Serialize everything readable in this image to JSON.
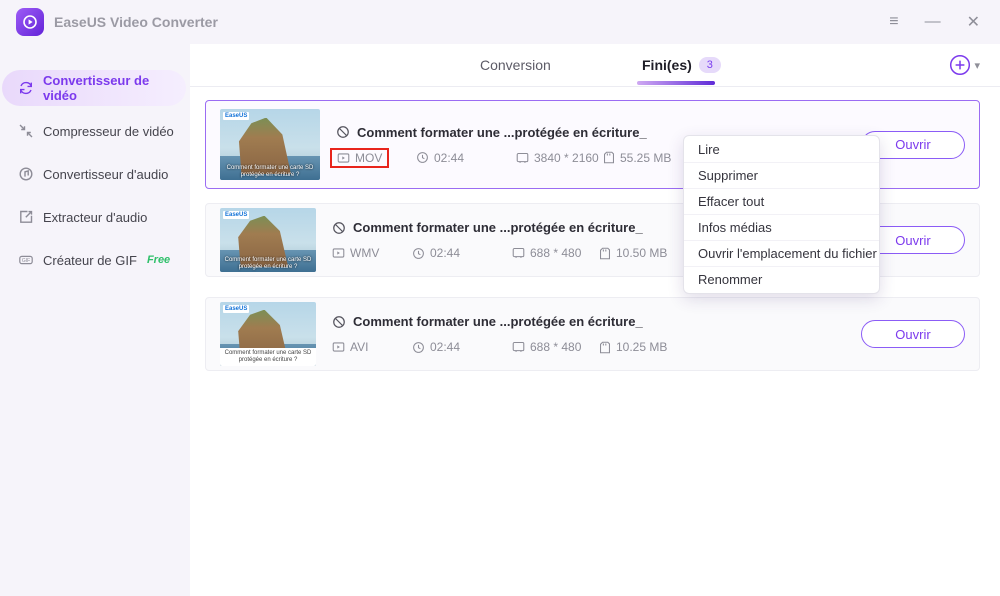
{
  "window": {
    "title": "EaseUS Video Converter",
    "controls": {
      "menu": "≡",
      "minimize": "—",
      "close": "✕"
    }
  },
  "sidebar": {
    "items": [
      {
        "label": "Convertisseur de vidéo",
        "active": true
      },
      {
        "label": "Compresseur de vidéo",
        "active": false
      },
      {
        "label": "Convertisseur d'audio",
        "active": false
      },
      {
        "label": "Extracteur d'audio",
        "active": false
      },
      {
        "label": "Créateur de GIF",
        "active": false,
        "badge": "Free"
      }
    ]
  },
  "tabs": {
    "conversion": "Conversion",
    "finished": "Fini(es)",
    "finished_count": "3"
  },
  "thumbnail": {
    "logo": "EaseUS",
    "caption": "Comment formater une carte SD protégée en écriture ?"
  },
  "files": [
    {
      "title": "Comment formater une ...protégée en écriture_",
      "format": "MOV",
      "duration": "02:44",
      "resolution": "3840 * 2160",
      "size": "55.25 MB",
      "open_label": "Ouvrir"
    },
    {
      "title": "Comment formater une ...protégée en écriture_",
      "format": "WMV",
      "duration": "02:44",
      "resolution": "688 * 480",
      "size": "10.50 MB",
      "open_label": "Ouvrir"
    },
    {
      "title": "Comment formater une ...protégée en écriture_",
      "format": "AVI",
      "duration": "02:44",
      "resolution": "688 * 480",
      "size": "10.25 MB",
      "open_label": "Ouvrir"
    }
  ],
  "context_menu": {
    "items": [
      "Lire",
      "Supprimer",
      "Effacer tout",
      "Infos médias",
      "Ouvrir l'emplacement du fichier",
      "Renommer"
    ]
  },
  "colors": {
    "accent": "#7c3aed",
    "annotation_box": "#e8241c",
    "free_badge": "#2fc06a"
  }
}
